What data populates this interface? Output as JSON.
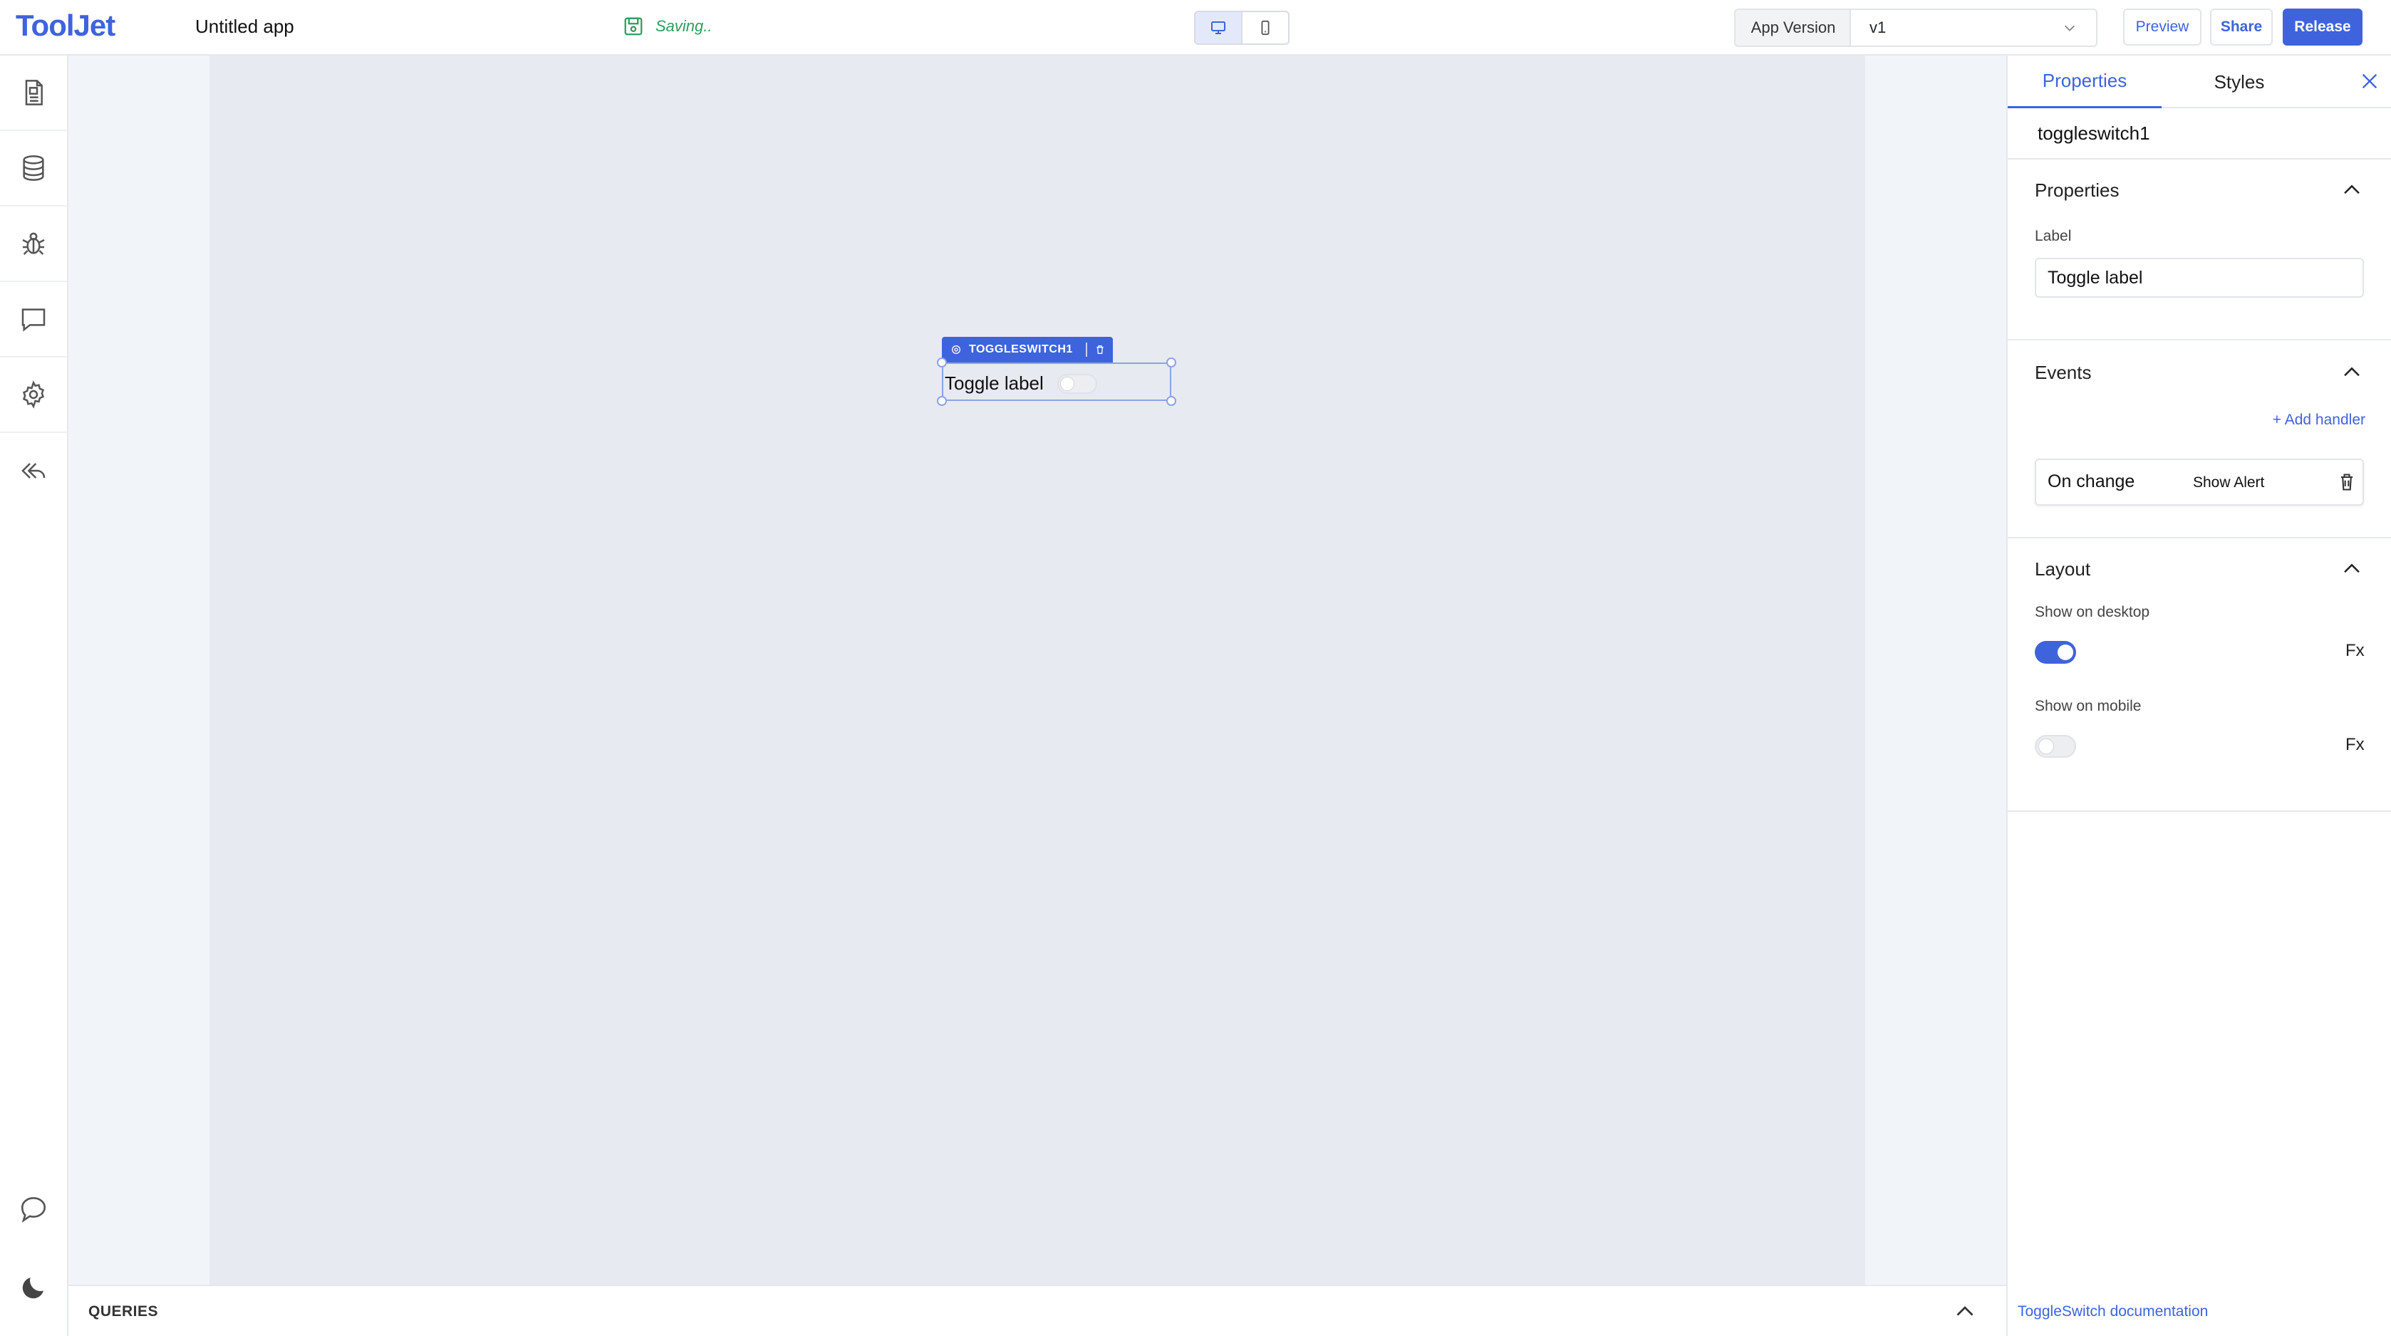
{
  "header": {
    "logo": "ToolJet",
    "app_name": "Untitled app",
    "saving_status": "Saving..",
    "app_version_label": "App Version",
    "app_version_value": "v1",
    "preview_label": "Preview",
    "share_label": "Share",
    "release_label": "Release"
  },
  "sidebar": {
    "items": [
      {
        "icon": "pages-icon"
      },
      {
        "icon": "database-icon"
      },
      {
        "icon": "debugger-icon"
      },
      {
        "icon": "comments-icon"
      },
      {
        "icon": "settings-icon"
      },
      {
        "icon": "back-icon"
      }
    ],
    "bottom": [
      {
        "icon": "chat-icon"
      },
      {
        "icon": "dark-mode-icon"
      }
    ]
  },
  "canvas": {
    "widget_tag": "TOGGLESWITCH1",
    "widget_label": "Toggle label"
  },
  "queries": {
    "label": "QUERIES"
  },
  "inspector": {
    "tabs": [
      "Properties",
      "Styles"
    ],
    "component_name": "toggleswitch1",
    "properties_section": {
      "title": "Properties",
      "label_field": "Label",
      "label_value": "Toggle label"
    },
    "events_section": {
      "title": "Events",
      "add_handler": "+ Add handler",
      "handler_event": "On change",
      "handler_action": "Show Alert"
    },
    "layout_section": {
      "title": "Layout",
      "show_on_desktop": "Show on desktop",
      "show_on_mobile": "Show on mobile",
      "fx": "Fx",
      "desktop_on": true,
      "mobile_on": false
    },
    "doc_link": "ToggleSwitch documentation"
  },
  "colors": {
    "accent": "#3e63dd",
    "saving": "#2e9c5d",
    "canvas": "#e7eaf1"
  }
}
